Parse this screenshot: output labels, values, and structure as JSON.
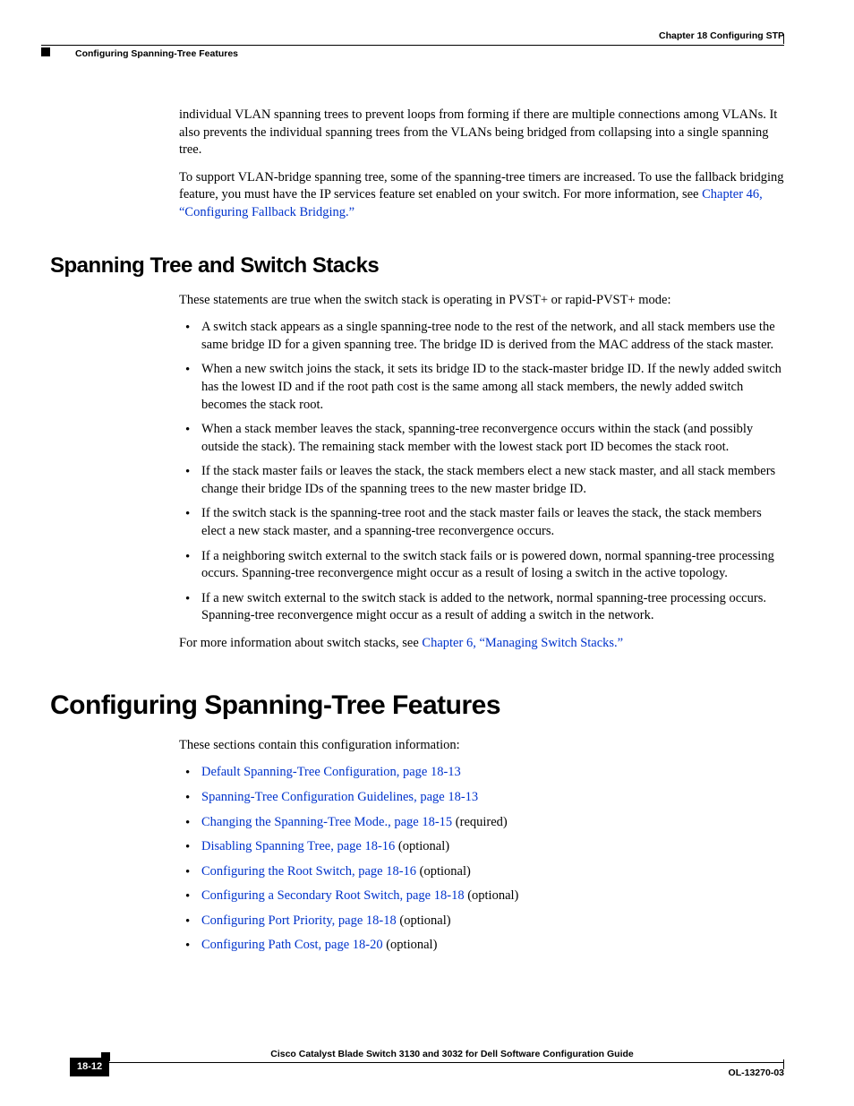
{
  "header": {
    "right": "Chapter 18    Configuring STP",
    "left": "Configuring Spanning-Tree Features"
  },
  "body": {
    "p1": "individual VLAN spanning trees to prevent loops from forming if there are multiple connections among VLANs. It also prevents the individual spanning trees from the VLANs being bridged from collapsing into a single spanning tree.",
    "p2a": "To support VLAN-bridge spanning tree, some of the spanning-tree timers are increased. To use the fallback bridging feature, you must have the IP services feature set enabled on your switch. For more information, see ",
    "p2link": "Chapter 46, “Configuring Fallback Bridging.”",
    "h2_1": "Spanning Tree and Switch Stacks",
    "p3": "These statements are true when the switch stack is operating in PVST+ or rapid-PVST+ mode:",
    "list1": {
      "b1": "A switch stack appears as a single spanning-tree node to the rest of the network, and all stack members use the same bridge ID for a given spanning tree. The bridge ID is derived from the MAC address of the stack master.",
      "b2": "When a new switch joins the stack, it sets its bridge ID to the stack-master bridge ID. If the newly added switch has the lowest ID and if the root path cost is the same among all stack members, the newly added switch becomes the stack root.",
      "b3": "When a stack member leaves the stack, spanning-tree reconvergence occurs within the stack (and possibly outside the stack). The remaining stack member with the lowest stack port ID becomes the stack root.",
      "b4": "If the stack master fails or leaves the stack, the stack members elect a new stack master, and all stack members change their bridge IDs of the spanning trees to the new master bridge ID.",
      "b5": "If the switch stack is the spanning-tree root and the stack master fails or leaves the stack, the stack members elect a new stack master, and a spanning-tree reconvergence occurs.",
      "b6": "If a neighboring switch external to the switch stack fails or is powered down, normal spanning-tree processing occurs. Spanning-tree reconvergence might occur as a result of losing a switch in the active topology.",
      "b7": "If a new switch external to the switch stack is added to the network, normal spanning-tree processing occurs. Spanning-tree reconvergence might occur as a result of adding a switch in the network."
    },
    "p4a": "For more information about switch stacks, see ",
    "p4link": "Chapter 6, “Managing Switch Stacks.”",
    "h1_1": "Configuring Spanning-Tree Features",
    "p5": "These sections contain this configuration information:",
    "list2": {
      "b1": "Default Spanning-Tree Configuration, page 18-13",
      "b2": "Spanning-Tree Configuration Guidelines, page 18-13",
      "b3": "Changing the Spanning-Tree Mode., page 18-15",
      "b3s": " (required)",
      "b4": "Disabling Spanning Tree, page 18-16",
      "b4s": " (optional)",
      "b5": "Configuring the Root Switch, page 18-16",
      "b5s": " (optional)",
      "b6": "Configuring a Secondary Root Switch, page 18-18",
      "b6s": " (optional)",
      "b7": "Configuring Port Priority, page 18-18",
      "b7s": " (optional)",
      "b8": "Configuring Path Cost, page 18-20",
      "b8s": " (optional)"
    }
  },
  "footer": {
    "title": "Cisco Catalyst Blade Switch 3130 and 3032 for Dell Software Configuration Guide",
    "page": "18-12",
    "doc": "OL-13270-03"
  }
}
